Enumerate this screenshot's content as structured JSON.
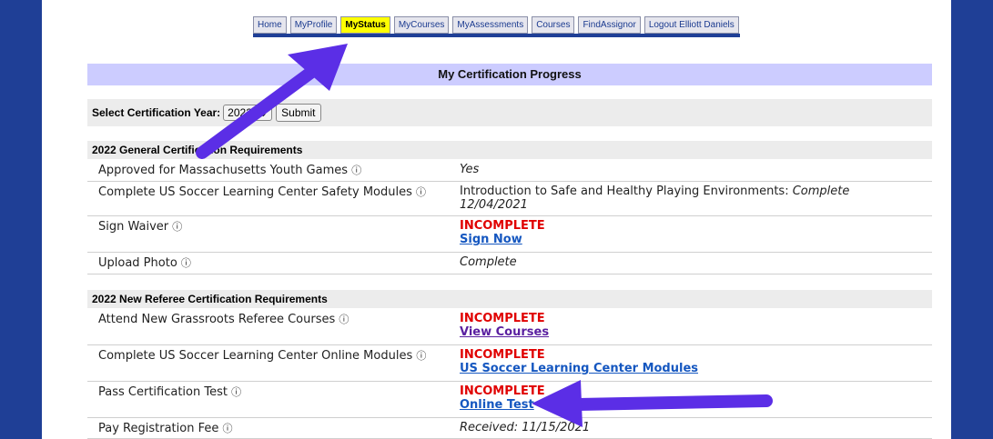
{
  "nav": {
    "tabs": [
      "Home",
      "MyProfile",
      "MyStatus",
      "MyCourses",
      "MyAssessments",
      "Courses",
      "FindAssignor",
      "Logout Elliott Daniels"
    ],
    "active": "MyStatus"
  },
  "page_title": "My Certification Progress",
  "year_form": {
    "label": "Select Certification Year:",
    "selected": "2022",
    "submit": "Submit"
  },
  "section1": {
    "heading": "2022 General Certification Requirements",
    "rows": [
      {
        "req": "Approved for Massachusetts Youth Games",
        "value": "Yes"
      },
      {
        "req": "Complete US Soccer Learning Center Safety Modules",
        "value": "Introduction to Safe and Healthy Playing Environments:",
        "status": "Complete",
        "date": "12/04/2021"
      },
      {
        "req": "Sign Waiver",
        "status": "INCOMPLETE",
        "link": "Sign Now"
      },
      {
        "req": "Upload Photo",
        "value": "Complete"
      }
    ]
  },
  "section2": {
    "heading": "2022 New Referee Certification Requirements",
    "rows": [
      {
        "req": "Attend New Grassroots Referee Courses",
        "status": "INCOMPLETE",
        "link": "View Courses"
      },
      {
        "req": "Complete US Soccer Learning Center Online Modules",
        "status": "INCOMPLETE",
        "link": "US Soccer Learning Center Modules"
      },
      {
        "req": "Pass Certification Test",
        "status": "INCOMPLETE",
        "link": "Online Test"
      },
      {
        "req": "Pay Registration Fee",
        "value": "Received: 11/15/2021"
      }
    ]
  },
  "info_glyph": "ⓘ",
  "colors": {
    "frame": "#1f3f96",
    "arrow": "#5b2ee6",
    "title_bg": "#ccccff",
    "active_tab": "#ffff00",
    "incomplete": "#e00000",
    "link": "#1557c0"
  }
}
